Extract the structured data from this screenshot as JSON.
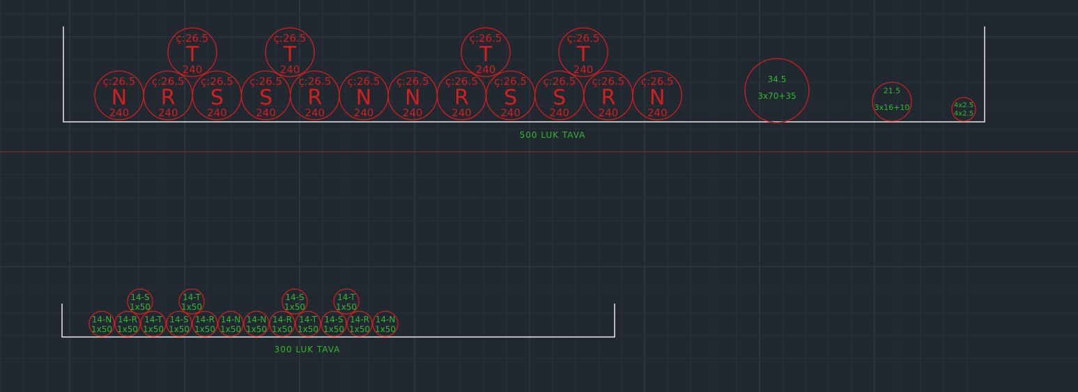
{
  "colors": {
    "background": "#212830",
    "grid_minor": "#2a313a",
    "grid_major": "#333b45",
    "red": "#d21f1f",
    "green": "#30b82f",
    "tray": "#e8e8e8",
    "axis": "#8a2d2d"
  },
  "tray_500": {
    "label": "500 LUK TAVA",
    "bottom_cables": [
      {
        "top": "ç:26.5",
        "phase": "N",
        "section": "240"
      },
      {
        "top": "ç:26.5",
        "phase": "R",
        "section": "240"
      },
      {
        "top": "ç:26.5",
        "phase": "S",
        "section": "240"
      },
      {
        "top": "ç:26.5",
        "phase": "S",
        "section": "240"
      },
      {
        "top": "ç:26.5",
        "phase": "R",
        "section": "240"
      },
      {
        "top": "ç:26.5",
        "phase": "N",
        "section": "240"
      },
      {
        "top": "ç:26.5",
        "phase": "N",
        "section": "240"
      },
      {
        "top": "ç:26.5",
        "phase": "R",
        "section": "240"
      },
      {
        "top": "ç:26.5",
        "phase": "S",
        "section": "240"
      },
      {
        "top": "ç:26.5",
        "phase": "S",
        "section": "240"
      },
      {
        "top": "ç:26.5",
        "phase": "R",
        "section": "240"
      },
      {
        "top": "ç:26.5",
        "phase": "N",
        "section": "240"
      }
    ],
    "top_cables": [
      {
        "top": "ç:26.5",
        "phase": "T",
        "section": "240"
      },
      {
        "top": "ç:26.5",
        "phase": "T",
        "section": "240"
      },
      {
        "top": "ç:26.5",
        "phase": "T",
        "section": "240"
      },
      {
        "top": "ç:26.5",
        "phase": "T",
        "section": "240"
      }
    ],
    "multicore_cables": [
      {
        "diameter": "34.5",
        "section": "3x70+35"
      },
      {
        "diameter": "21.5",
        "section": "3x16+10"
      },
      {
        "diameter": "4x2.5",
        "section": "4x2.5"
      }
    ]
  },
  "tray_300": {
    "label": "300 LUK TAVA",
    "bottom_cables": [
      {
        "id": "14-N",
        "section": "1x50"
      },
      {
        "id": "14-R",
        "section": "1x50"
      },
      {
        "id": "14-T",
        "section": "1x50"
      },
      {
        "id": "14-S",
        "section": "1x50"
      },
      {
        "id": "14-R",
        "section": "1x50"
      },
      {
        "id": "14-N",
        "section": "1x50"
      },
      {
        "id": "14-N",
        "section": "1x50"
      },
      {
        "id": "14-R",
        "section": "1x50"
      },
      {
        "id": "14-T",
        "section": "1x50"
      },
      {
        "id": "14-S",
        "section": "1x50"
      },
      {
        "id": "14-R",
        "section": "1x50"
      },
      {
        "id": "14-N",
        "section": "1x50"
      }
    ],
    "top_cables": [
      {
        "id": "14-S",
        "section": "1x50"
      },
      {
        "id": "14-T",
        "section": "1x50"
      },
      {
        "id": "14-S",
        "section": "1x50"
      },
      {
        "id": "14-T",
        "section": "1x50"
      }
    ]
  }
}
